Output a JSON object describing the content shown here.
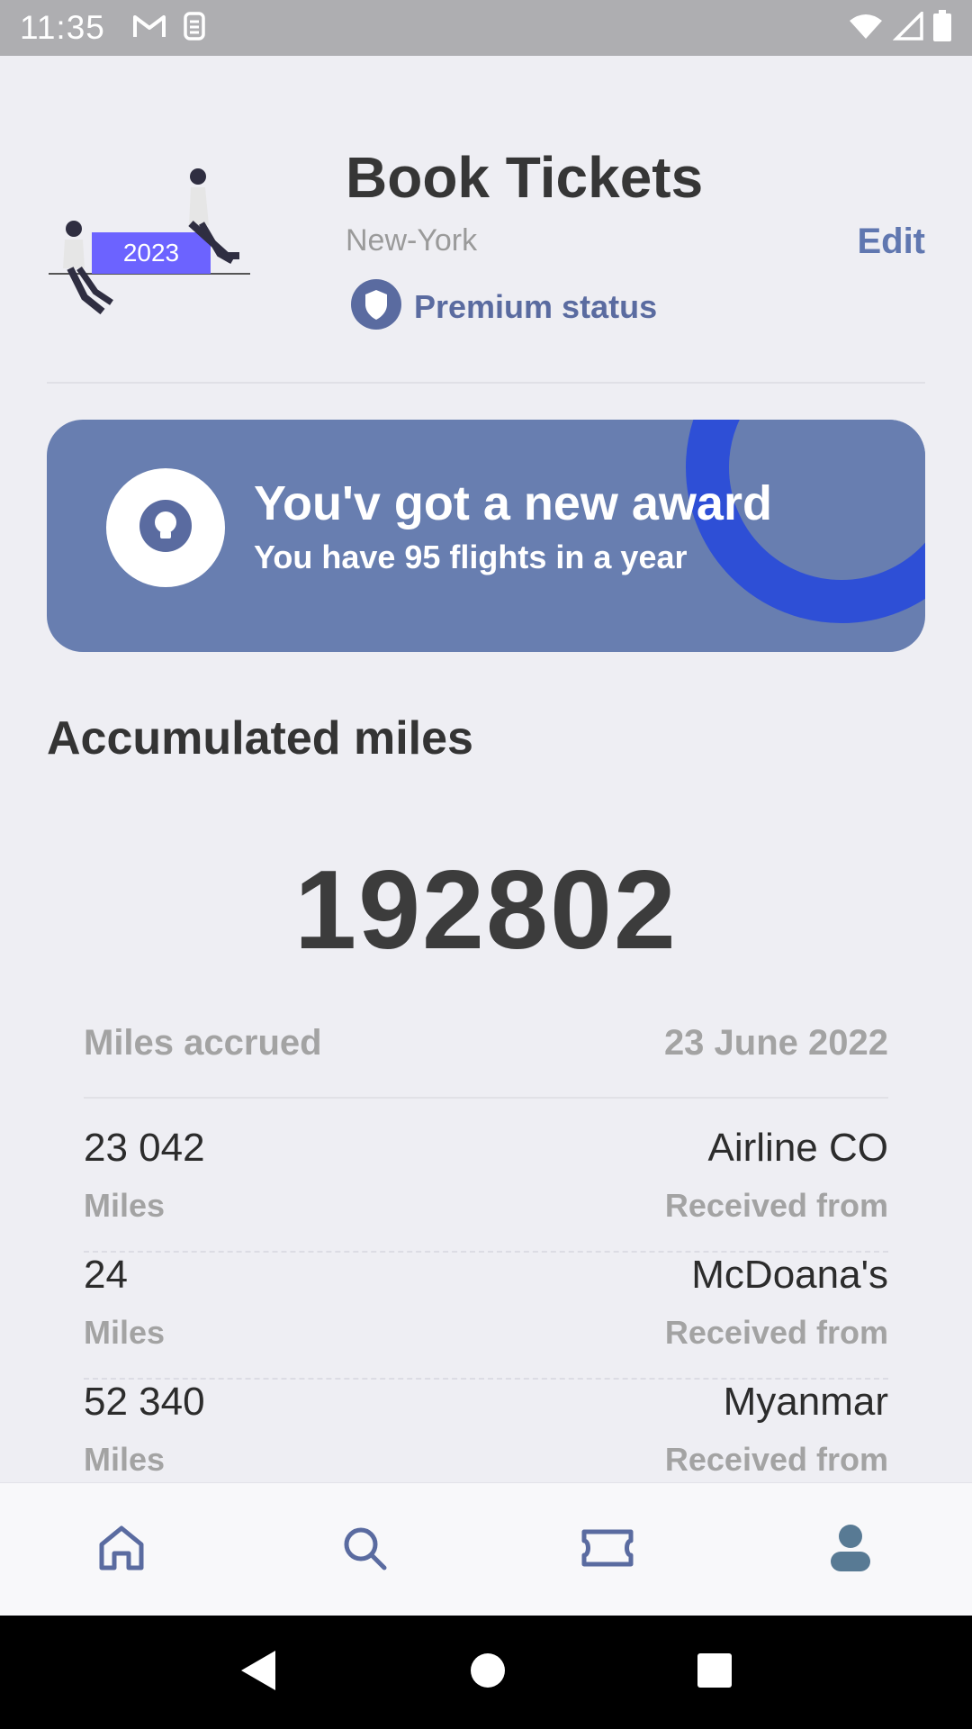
{
  "status_bar": {
    "time": "11:35",
    "icons": [
      "gmail-icon",
      "sim-icon",
      "wifi-icon",
      "signal-icon",
      "battery-icon"
    ]
  },
  "header": {
    "title": "Book Tickets",
    "subtitle": "New-York",
    "badge_label": "Premium status",
    "edit_label": "Edit",
    "illustration_text": "2023"
  },
  "award": {
    "title": "You'v got a new award",
    "subtitle": "You have 95 flights in a year",
    "icon": "lightbulb-icon"
  },
  "miles": {
    "section_title": "Accumulated miles",
    "total": "192802",
    "list_header_left": "Miles accrued",
    "list_header_right": "23 June 2022",
    "entries": [
      {
        "amount": "23 042",
        "unit": "Miles",
        "source": "Airline CO",
        "note": "Received from"
      },
      {
        "amount": "24",
        "unit": "Miles",
        "source": "McDoana's",
        "note": "Received from"
      },
      {
        "amount": "52 340",
        "unit": "Miles",
        "source": "Myanmar",
        "note": "Received from"
      }
    ]
  },
  "bottom_nav": [
    "home-icon",
    "search-icon",
    "ticket-icon",
    "profile-icon"
  ],
  "colors": {
    "accent": "#687eb0",
    "accent_dark": "#5a6ba0",
    "ring": "#2e4fd6",
    "background": "#eeeef3"
  }
}
